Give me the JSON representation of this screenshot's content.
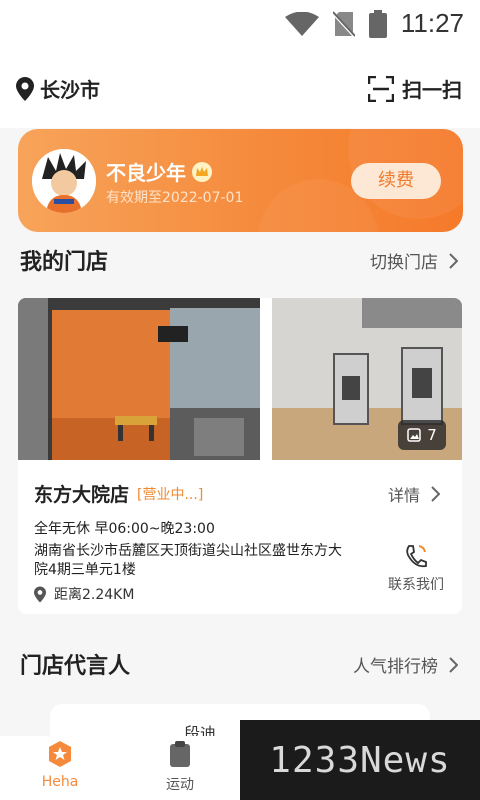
{
  "status_bar": {
    "time": "11:27"
  },
  "header": {
    "city": "长沙市",
    "scan_label": "扫一扫"
  },
  "member": {
    "name": "不良少年",
    "expiry": "有效期至2022-07-01",
    "renew_label": "续费",
    "accent": "#f58a3c"
  },
  "my_store": {
    "title": "我的门店",
    "switch_label": "切换门店",
    "photo_count": "7",
    "name": "东方大院店",
    "status": "[营业中...]",
    "detail_label": "详情",
    "hours": "全年无休 早06:00~晚23:00",
    "address": "湖南省长沙市岳麓区天顶街道尖山社区盛世东方大院4期三单元1楼",
    "distance": "距离2.24KM",
    "contact_label": "联系我们"
  },
  "spokesperson": {
    "title": "门店代言人",
    "ranking_label": "人气排行榜",
    "peek_text": "段迪"
  },
  "tabs": [
    {
      "label": "Heha",
      "icon": "star-badge-icon",
      "active": true
    },
    {
      "label": "运动",
      "icon": "clipboard-icon",
      "active": false
    }
  ],
  "watermark": "1233News"
}
